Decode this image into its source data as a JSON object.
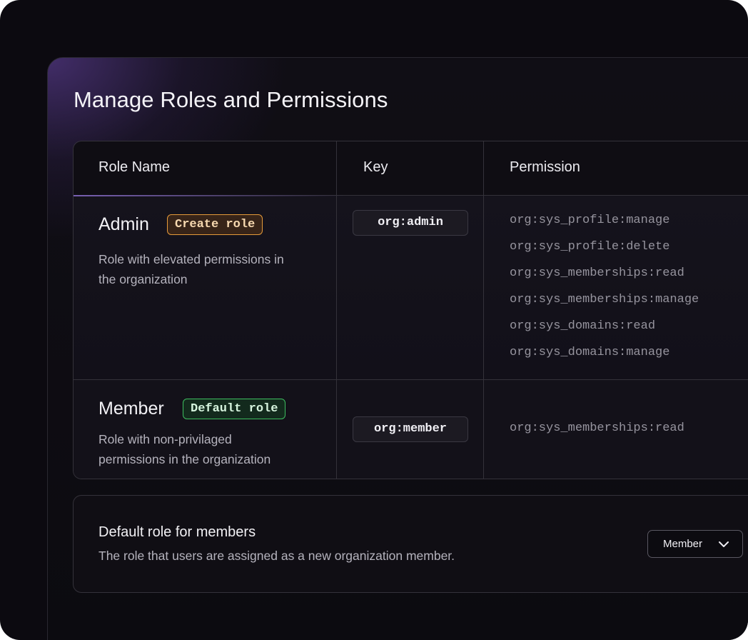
{
  "page": {
    "title": "Manage Roles and Permissions"
  },
  "table": {
    "headers": {
      "role_name": "Role Name",
      "key": "Key",
      "permission": "Permission"
    },
    "rows": [
      {
        "name": "Admin",
        "badge": "Create role",
        "badge_color": "#e59a3a",
        "description_line1": "Role with elevated permissions in",
        "description_line2": "the organization",
        "key": "org:admin",
        "permissions": [
          "org:sys_profile:manage",
          "org:sys_profile:delete",
          "org:sys_memberships:read",
          "org:sys_memberships:manage",
          "org:sys_domains:read",
          "org:sys_domains:manage"
        ]
      },
      {
        "name": "Member",
        "badge": "Default role",
        "badge_color": "#3dbd5f",
        "description_line1": "Role with non-privilaged",
        "description_line2": "permissions in the organization",
        "key": "org:member",
        "permissions": [
          "org:sys_memberships:read"
        ]
      }
    ]
  },
  "default_role": {
    "title": "Default role for members",
    "description": "The role that users are assigned as a new organization member.",
    "select_value": "Member",
    "select_icon": "chevron-down-icon"
  },
  "colors": {
    "background": "#0c0a10",
    "accent_purple": "#6c47af"
  }
}
